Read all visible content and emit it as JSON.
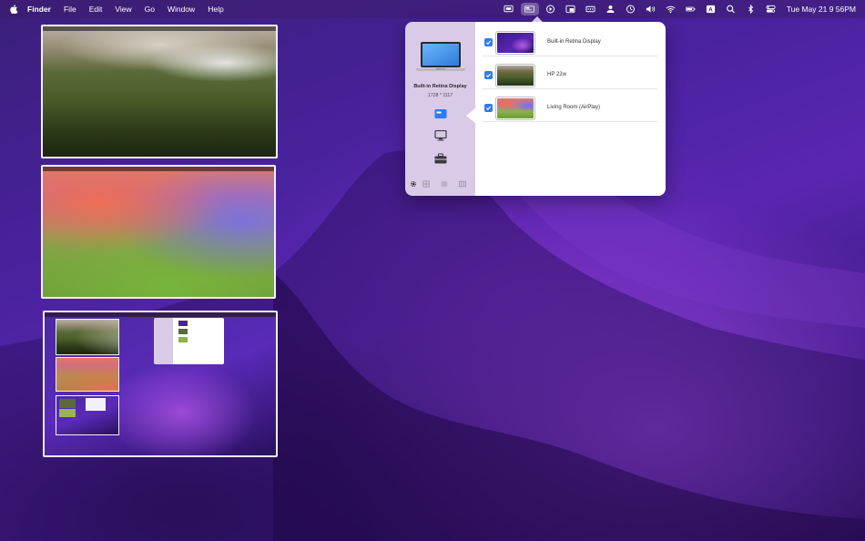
{
  "menubar": {
    "app_name": "Finder",
    "menus": [
      "File",
      "Edit",
      "View",
      "Go",
      "Window",
      "Help"
    ],
    "status_icons": [
      "display-menu-icon",
      "displays-app-icon",
      "play-circle-icon",
      "screen-mirror-icon",
      "keyboard-brightness-icon",
      "user-icon",
      "time-machine-icon",
      "volume-icon",
      "wifi-icon",
      "battery-icon",
      "input-source-icon",
      "spotlight-search-icon",
      "bluetooth-icon",
      "control-center-icon"
    ],
    "input_source": "A",
    "clock": "Tue May 21  9 56PM"
  },
  "popover": {
    "selected_display": {
      "name": "Built-in Retina Display",
      "resolution": "1728 * 1117"
    },
    "displays": [
      {
        "name": "Built-in Retina Display",
        "checked": true,
        "wallpaper": "monterey"
      },
      {
        "name": "HP 22w",
        "checked": true,
        "wallpaper": "sierra"
      },
      {
        "name": "Living Room (AirPlay)",
        "checked": true,
        "wallpaper": "sonoma"
      }
    ],
    "side_icons": [
      "display-settings-icon",
      "monitor-icon",
      "toolbox-icon"
    ],
    "bottom_icons": [
      "gear-icon",
      "grid-icon",
      "list-icon",
      "layout-icon"
    ]
  },
  "colors": {
    "accent": "#2f7bf6",
    "sidebar": "#d9cbe8",
    "menubar": "#3c1e6e"
  }
}
